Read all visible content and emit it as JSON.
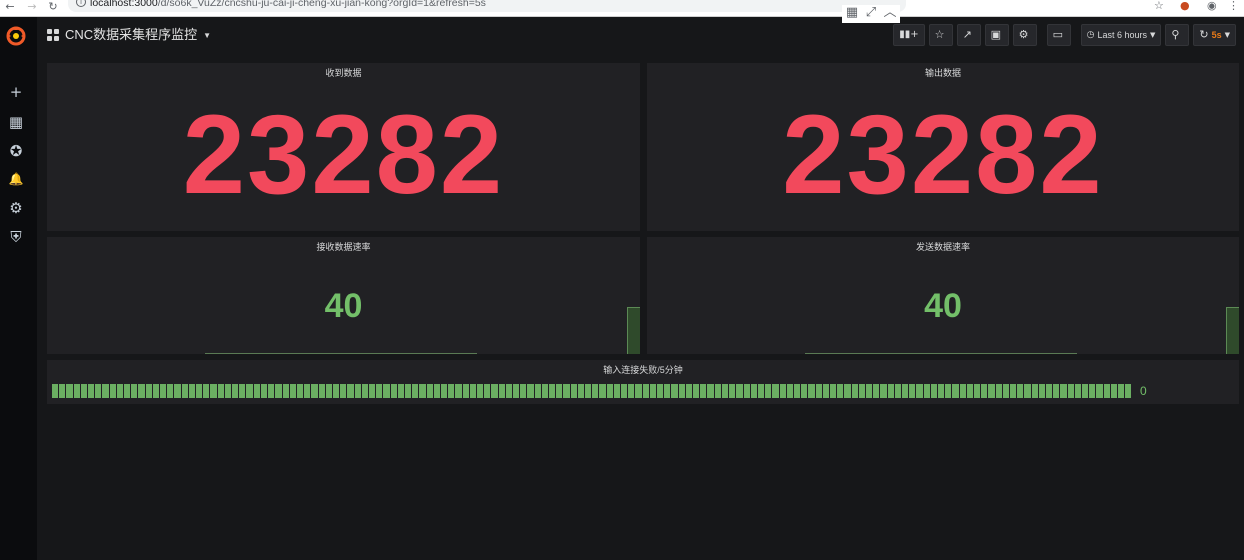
{
  "browser": {
    "url_host": "localhost:3000",
    "url_path": "/d/so6k_VuZz/cncshu-ju-cai-ji-cheng-xu-jian-kong?orgId=1&refresh=5s",
    "back": "←",
    "forward": "→",
    "reload": "↻",
    "star": "☆"
  },
  "sidebar": {
    "items": [
      {
        "name": "create",
        "glyph": "+"
      },
      {
        "name": "dashboards",
        "glyph": "▦"
      },
      {
        "name": "explore",
        "glyph": "✪"
      },
      {
        "name": "alerting",
        "glyph": "🔔"
      },
      {
        "name": "configuration",
        "glyph": "⚙"
      },
      {
        "name": "server-admin",
        "glyph": "⛨"
      }
    ]
  },
  "navbar": {
    "title": "CNC数据采集程序监控",
    "time_range": "Last 6 hours",
    "refresh": "5s"
  },
  "panels": {
    "received": {
      "title": "收到数据",
      "value": "23282"
    },
    "output": {
      "title": "输出数据",
      "value": "23282"
    },
    "recv_rate": {
      "title": "接收数据速率",
      "value": "40"
    },
    "send_rate": {
      "title": "发送数据速率",
      "value": "40"
    },
    "input_fail": {
      "title": "输入连接失败/5分钟",
      "value": "0",
      "fill_fraction": 1.0
    }
  },
  "colors": {
    "big_value": "#f2495c",
    "rate_value": "#73bf69",
    "refresh": "#eb7b18"
  }
}
